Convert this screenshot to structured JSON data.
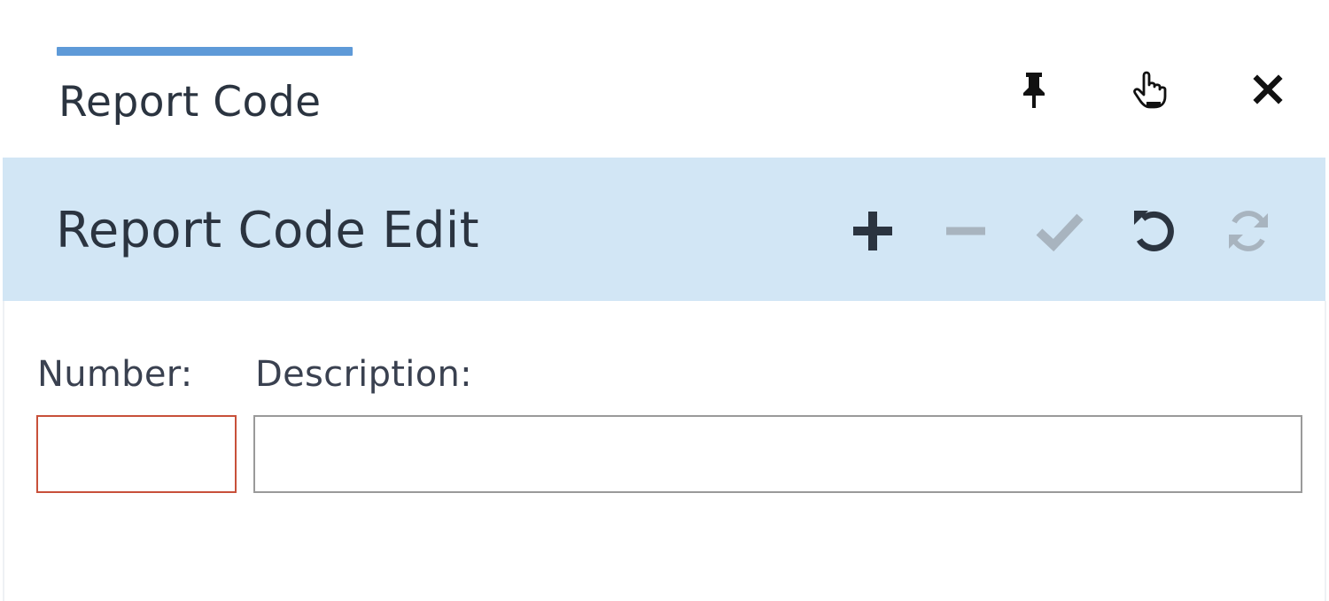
{
  "window": {
    "tab_title": "Report Code",
    "controls": [
      {
        "name": "pin-icon",
        "tooltip": "Pin"
      },
      {
        "name": "pointer-hand-icon",
        "tooltip": "Select"
      },
      {
        "name": "close-icon",
        "tooltip": "Close"
      }
    ]
  },
  "panel": {
    "title": "Report Code Edit",
    "toolbar": [
      {
        "name": "add",
        "icon": "plus-icon",
        "enabled": true
      },
      {
        "name": "remove",
        "icon": "minus-icon",
        "enabled": false
      },
      {
        "name": "save",
        "icon": "check-icon",
        "enabled": false
      },
      {
        "name": "undo",
        "icon": "undo-icon",
        "enabled": true
      },
      {
        "name": "refresh",
        "icon": "refresh-icon",
        "enabled": false
      }
    ]
  },
  "form": {
    "number": {
      "label": "Number:",
      "value": "",
      "placeholder": "",
      "required": true
    },
    "description": {
      "label": "Description:",
      "value": "",
      "placeholder": ""
    }
  },
  "colors": {
    "accent": "#5e9ad8",
    "header_bg": "#d2e6f5",
    "text": "#2b3440",
    "icon_enabled": "#2b3440",
    "icon_disabled": "#a8b4bf",
    "required_border": "#c8503a",
    "input_border": "#9a9a9a"
  }
}
